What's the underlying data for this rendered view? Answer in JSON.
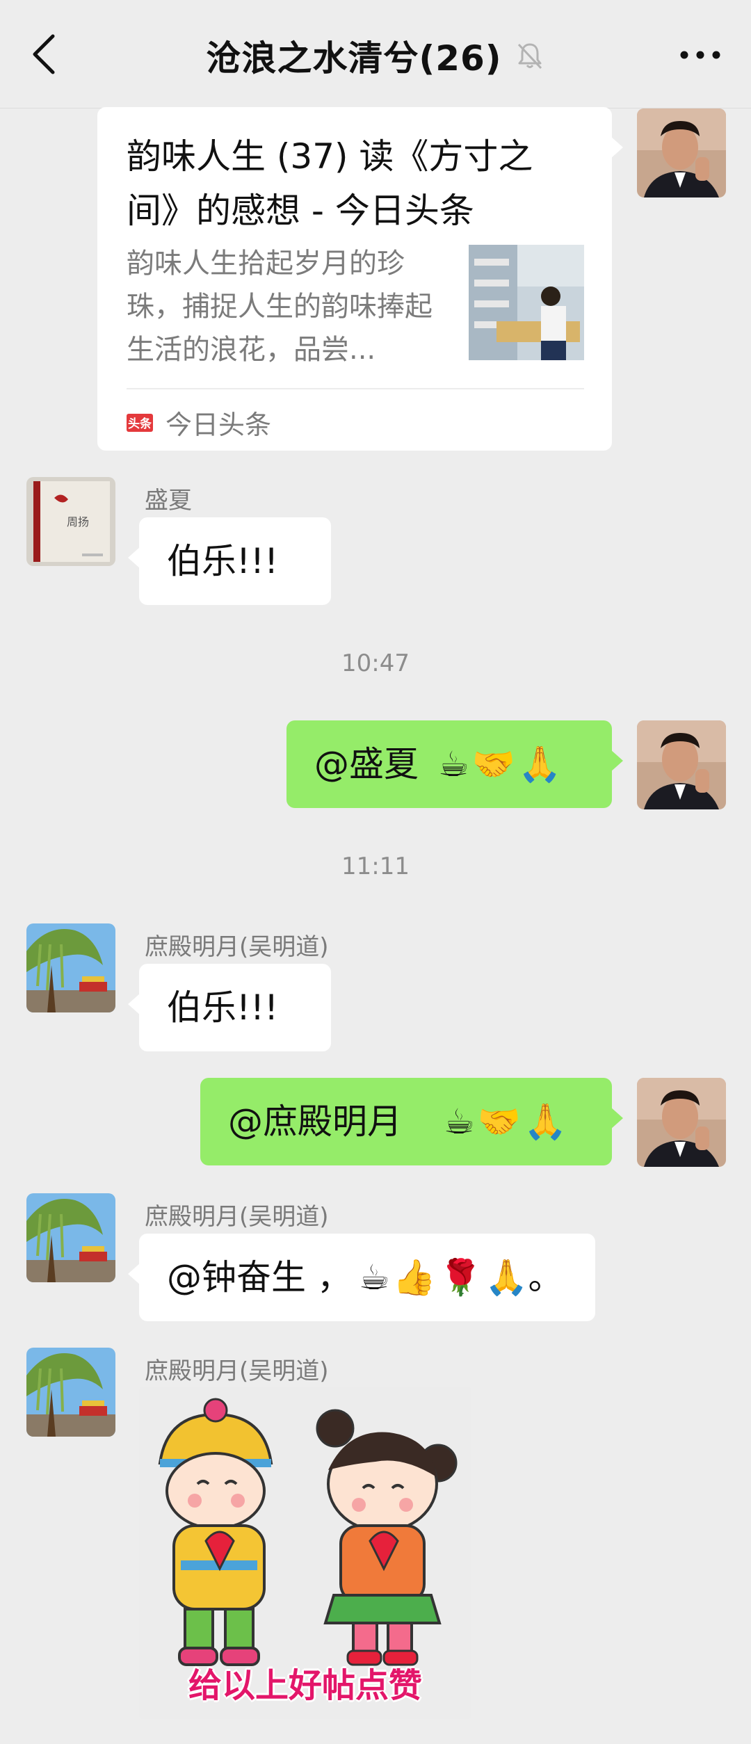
{
  "header": {
    "title": "沧浪之水清兮(26)",
    "back_icon": "chevron-left-icon",
    "mute_icon": "bell-muted-icon",
    "more_icon": "more-dots-icon"
  },
  "link_card": {
    "title": "韵味人生 (37) 读《方寸之间》的感想 - 今日头条",
    "description": "韵味人生拾起岁月的珍珠，捕捉人生的韵味捧起生活的浪花，品尝...",
    "source_logo": "头条",
    "source_name": "今日头条"
  },
  "messages": {
    "m1": {
      "sender": "盛夏",
      "text": "伯乐!!!"
    },
    "time1": "10:47",
    "m2": {
      "text": "@盛夏",
      "emojis": [
        "☕",
        "🤝",
        "🙏"
      ]
    },
    "time2": "11:11",
    "m3": {
      "sender": "庶殿明月(吴明道)",
      "text": "伯乐!!!"
    },
    "m4": {
      "text": "@庶殿明月",
      "emojis": [
        "☕",
        "🤝",
        "🙏"
      ]
    },
    "m5": {
      "sender": "庶殿明月(吴明道)",
      "text": "@钟奋生 ，",
      "emojis": [
        "☕",
        "👍",
        "🌹",
        "🙏"
      ],
      "suffix": "。"
    },
    "m6": {
      "sender": "庶殿明月(吴明道)",
      "sticker_caption": "给以上好帖点赞"
    }
  },
  "colors": {
    "background": "#ededed",
    "bubble_self": "#95ec69",
    "bubble_other": "#ffffff",
    "sticker_caption": "#e3166a"
  }
}
